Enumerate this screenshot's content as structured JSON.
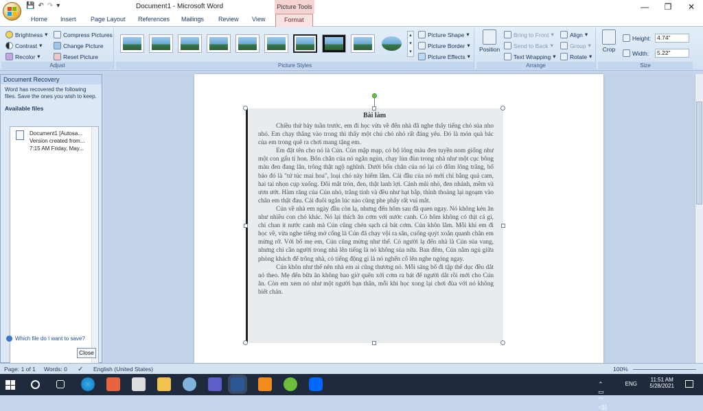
{
  "window": {
    "title": "Document1 - Microsoft Word",
    "context_tab_title": "Picture Tools",
    "controls": {
      "minimize": "—",
      "maximize": "❐",
      "close": "✕"
    }
  },
  "qat": {
    "save": "💾",
    "undo": "↶",
    "redo": "↷",
    "more": "▾"
  },
  "tabs": [
    "Home",
    "Insert",
    "Page Layout",
    "References",
    "Mailings",
    "Review",
    "View",
    "Format"
  ],
  "ribbon": {
    "adjust": {
      "label": "Adjust",
      "brightness": "Brightness",
      "contrast": "Contrast",
      "recolor": "Recolor",
      "compress": "Compress Pictures",
      "change": "Change Picture",
      "reset": "Reset Picture"
    },
    "styles": {
      "label": "Picture Styles",
      "shape": "Picture Shape",
      "border": "Picture Border",
      "effects": "Picture Effects"
    },
    "arrange": {
      "label": "Arrange",
      "position": "Position",
      "bring_front": "Bring to Front",
      "send_back": "Send to Back",
      "text_wrapping": "Text Wrapping",
      "align": "Align",
      "group": "Group",
      "rotate": "Rotate"
    },
    "size": {
      "label": "Size",
      "crop": "Crop",
      "height_label": "Height:",
      "height": "4.74\"",
      "width_label": "Width:",
      "width": "5.22\""
    }
  },
  "recovery": {
    "title": "Document Recovery",
    "message": "Word has recovered the following files.  Save the ones you wish to keep.",
    "available": "Available files",
    "file_name": "Document1  [Autosa...",
    "file_line2": "Version created from...",
    "file_line3": "7:15 AM Friday, May...",
    "help": "Which file do I want to save?",
    "close": "Close"
  },
  "image_text": {
    "title": "Bài làm",
    "paragraphs": [
      "Chiều thứ bảy tuần trước, em đi học vừa về đến nhà đã nghe thấy tiếng chó sủa nho nhỏ. Em chạy thẳng vào trong thì thấy một chú chó nhỏ rất đáng yêu. Đó là món quà bác của em trong quê ra chơi mang tặng em.",
      "Em đặt tên cho nó là Cún. Cún mập mạp, có bộ lông màu đen tuyền nom giống như một con gấu tí hon. Bốn chân của nó ngắn ngủn, chạy lùn đùn trong nhà như một cục bông màu đen đang lăn, trông thật ngộ nghĩnh. Dưới bốn chân của nó lại có đốm lông trắng, bố bảo đó là \"tứ túc mai hoa\", loại chó này hiếm lắm. Cái đầu của nó mới chỉ bằng quả cam, hai tai nhọn cụp xuống. Đôi mắt tròn, đen, thật lanh lợi. Cánh mũi nhỏ, đen nhánh, mềm và ươn ướt. Hàm răng của Cún nhỏ, trắng tinh và đều như hạt bắp, thỉnh thoảng lại ngoạm vào chân em thật đau. Cái đuôi ngắn lúc nào cũng phe phẩy rất vui mắt.",
      "Cún về nhà em ngày đầu còn lạ, nhưng đến hôm sau đã quen ngay. Nó không kén ăn như nhiều con chó khác. Nó lại thích ăn cơm với nước canh. Có hôm không có thịt cá gì, chỉ chan ít nước canh mà Cún cũng chén sạch cả bát cơm. Cún khôn lắm. Mỗi khi em đi học về, vừa nghe tiếng mở cổng là Cún đã chạy vội ra sân, cuống quýt xoắn quanh chân em mừng rỡ. Với bố mẹ em, Cún cũng mừng như thế. Có người lạ đến nhà là Cún sủa vang, nhưng chỉ cần người trong nhà lên tiếng là nó không sủa nữa. Ban đêm, Cún nằm ngủ giữa phòng khách để trông nhà, có tiếng động gì là nó nghển cổ lên nghe ngóng ngay.",
      "Cún khôn như thế nên nhà em ai cũng thương nó. Mỗi sáng bố đi tập thể dục đều dắt nó theo. Mẹ đến bữa ăn không bao giờ quên xới cơm ra bát để người dắt rồi mới cho Cún ăn. Còn em xem nó như một người bạn thân, mỗi khi học xong lại chơi đùa với nó không biết chán."
    ]
  },
  "status": {
    "page": "Page: 1 of 1",
    "words": "Words: 0",
    "language": "English (United States)",
    "zoom": "100%"
  },
  "taskbar": {
    "time": "11:51 AM",
    "date": "5/28/2021",
    "lang": "ENG"
  }
}
